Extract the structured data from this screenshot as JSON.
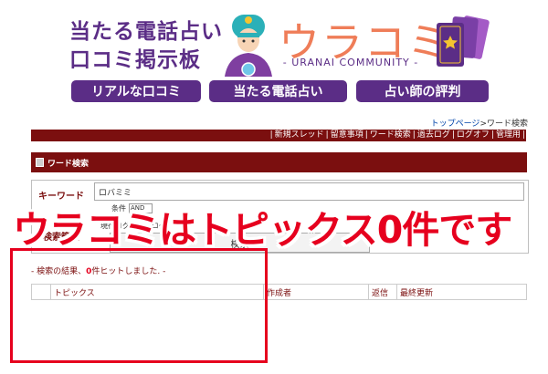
{
  "header": {
    "subtitle_line1": "当たる電話占い",
    "subtitle_line2": "口コミ掲示板",
    "logo_text": "ウラコミ",
    "logo_sub": "- URANAI COMMUNITY -",
    "nav": [
      "リアルな口コミ",
      "当たる電話占い",
      "占い師の評判"
    ]
  },
  "breadcrumb": {
    "home": "トップページ",
    "sep": ">",
    "current": "ワード検索"
  },
  "toplinks": [
    "|",
    "新規スレッド",
    "|",
    "留意事項",
    "|",
    "ワード検索",
    "|",
    "過去ログ",
    "|",
    "ログオフ",
    "|",
    "管理用",
    "|"
  ],
  "panel": {
    "title": "ワード検索"
  },
  "form": {
    "keyword_label": "キーワード",
    "keyword_value": "ロバミミ",
    "condition_label": "条件",
    "condition_value": "AND",
    "range_label": "検索範囲",
    "range_text": "現行ログ / 過去ログ",
    "search_button": "検索"
  },
  "overlay_text": "ウラコミはトピックス0件です",
  "result": {
    "prefix": "- 検索の結果、",
    "count": "0",
    "suffix": "件ヒットしました. -"
  },
  "table": {
    "headers": [
      "",
      "トピックス",
      "作成者",
      "返信",
      "最終更新"
    ]
  },
  "colors": {
    "accent": "#5b2d86",
    "logo": "#ef7d58",
    "bar": "#7b0f0f",
    "alert": "#e6001e"
  },
  "icons": [
    "fortune-teller-icon",
    "tarot-cards-icon",
    "document-icon"
  ]
}
